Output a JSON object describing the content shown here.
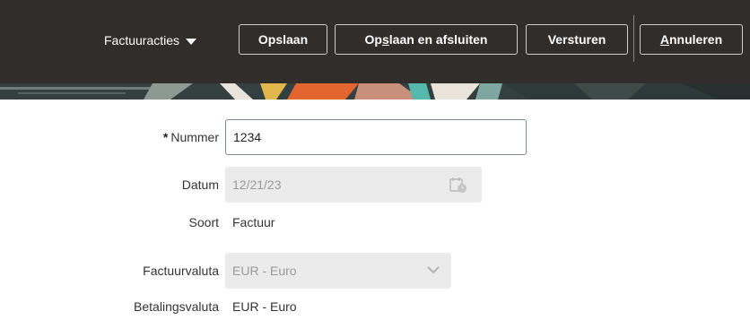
{
  "toolbar": {
    "actions_menu_label": "Factuuracties",
    "save_label": "Opslaan",
    "save_close_label_pre": "Op",
    "save_close_label_mnemonic": "s",
    "save_close_label_post": "laan en afsluiten",
    "send_label": "Versturen",
    "cancel_label_mnemonic": "A",
    "cancel_label_post": "nnuleren"
  },
  "form": {
    "number": {
      "required_mark": "*",
      "label": "Nummer",
      "value": "1234"
    },
    "date": {
      "label": "Datum",
      "value": "12/21/23",
      "icon": "calendar-icon"
    },
    "type": {
      "label": "Soort",
      "value": "Factuur"
    },
    "invoice_currency": {
      "label": "Factuurvaluta",
      "value": "EUR - Euro",
      "icon": "chevron-down-icon"
    },
    "payment_currency": {
      "label": "Betalingsvaluta",
      "value": "EUR - Euro"
    }
  },
  "colors": {
    "toolbar_bg": "#312d2a",
    "readonly_field_bg": "#ebebeb"
  }
}
